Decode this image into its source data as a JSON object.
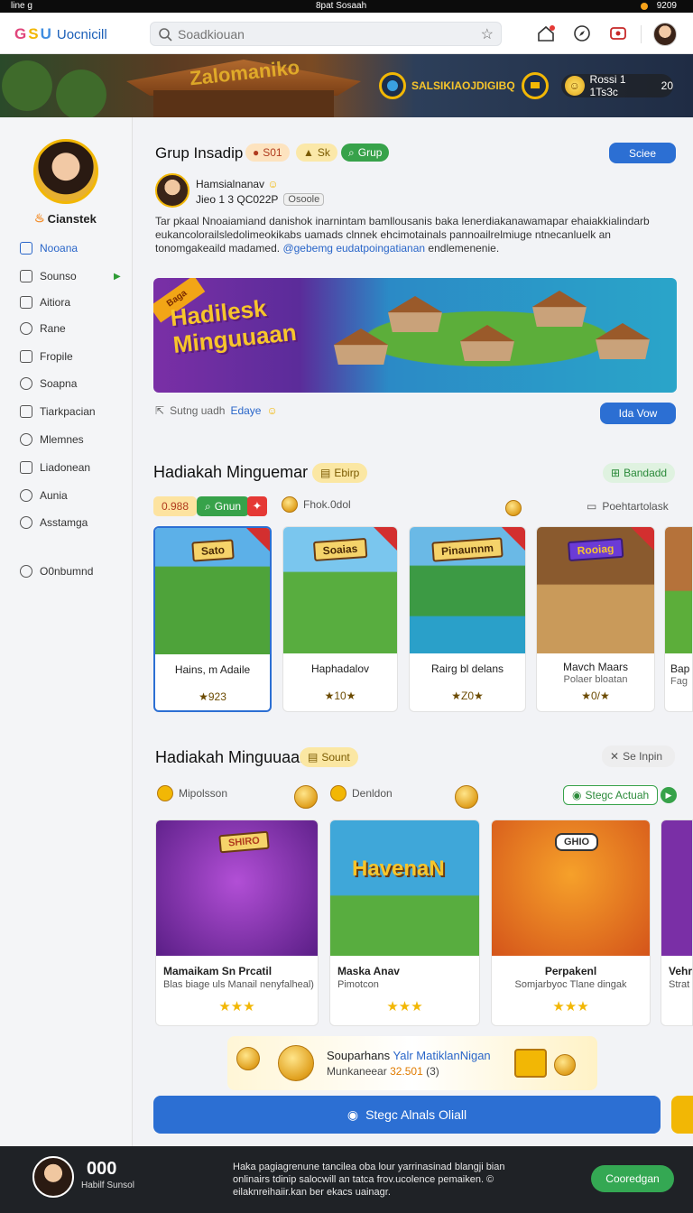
{
  "status_bar": {
    "left": "line g",
    "center": "8pat Sosaah",
    "right": "9209"
  },
  "topbar": {
    "logo_letters": [
      "G",
      "S",
      "U"
    ],
    "app_name": "Uocnicill",
    "search_placeholder": "Soadkiouan"
  },
  "banner": {
    "watermark": "Zalomaniko",
    "badge_text": "SALSIKIAOJDIGIBQ",
    "coins_label": "Rossi 1 1Ts3c",
    "coins_value": "20"
  },
  "sidebar": {
    "user_name": "Cianstek",
    "items": [
      {
        "label": "Nooana",
        "active": true
      },
      {
        "label": "Sounso",
        "active": false,
        "has_arrow": true
      },
      {
        "label": "Aitiora",
        "active": false
      },
      {
        "label": "Rane",
        "active": false
      },
      {
        "label": "Fropile",
        "active": false
      },
      {
        "label": "Soapna",
        "active": false
      },
      {
        "label": "Tiarkpacian",
        "active": false
      },
      {
        "label": "Mlemnes",
        "active": false
      },
      {
        "label": "Liadonean",
        "active": false
      },
      {
        "label": "Aunia",
        "active": false
      },
      {
        "label": "Asstamga",
        "active": false
      },
      {
        "label": "O0nbumnd",
        "active": false
      }
    ]
  },
  "group": {
    "title": "Grup Insadip",
    "chip_a": "S01",
    "chip_b": "Sk",
    "chip_c": "Grup",
    "join_label": "Sciee",
    "author_name": "Hamsialnanav",
    "author_id": "Jieo 1 3 QC022P",
    "author_tag": "Osoole",
    "description": "Tar pkaal Nnoaiamiand danishok inarnintam bamllousanis baka lenerdiakanawamapar ehaiakkialindarb eukancolorailsledolimeokikabs uamads clnnek ehcimotainals pannoailrelmiuge ntnecanluelk an tonomgakeaild madamed.",
    "description_link": "@gebemg eudatpoingatianan",
    "description_tail": "endlemenenie."
  },
  "hero": {
    "ribbon": "Baga",
    "title_line1": "Hadilesk",
    "title_line2": "Minguuaan",
    "footer_text": "Sutng uadh",
    "footer_link": "Edaye",
    "more_label": "Ida Vow"
  },
  "section1": {
    "title": "Hadiakah Minguemar",
    "title_pill": "Ebirp",
    "right_pill": "Bandadd",
    "filters": [
      {
        "label": "0.988"
      },
      {
        "label": "Gnun"
      },
      {
        "label": "Fhok.0dol"
      }
    ],
    "right_link": "Poehtartolask",
    "cards": [
      {
        "sign": "Sato",
        "name": "Hains, m Adaile",
        "rating": "★923"
      },
      {
        "sign": "Soaias",
        "name": "Haphadalov",
        "rating": "★10★"
      },
      {
        "sign": "Pinaunnm",
        "name": "Rairg bl delans",
        "rating": "★Z0★"
      },
      {
        "sign": "Rooiag",
        "name": "Mavch Maars",
        "sub": "Polaer bloatan",
        "rating": "★0/★"
      },
      {
        "sign": "",
        "name": "Bap",
        "sub": "Fag",
        "rating": ""
      }
    ]
  },
  "section2": {
    "title": "Hadiakah Minguuaan",
    "title_pill": "Sount",
    "right_pill": "Se Inpin",
    "filter_left": "Mipolsson",
    "filter_mid": "Denldon",
    "action_pill": "Stegc Actuah",
    "cards": [
      {
        "sign": "SHIRO",
        "name": "Mamaikam Sn Prcatil",
        "sub": "Blas biage uls Manail nenyfalheal)",
        "stars": "★★★"
      },
      {
        "sign": "HavenaN",
        "name": "Maska Anav",
        "sub": "Pimotcon",
        "stars": "★★★"
      },
      {
        "sign": "GHIO",
        "name": "Perpakenl",
        "sub": "Somjarbyoc Tlane dingak",
        "stars": "★★★"
      },
      {
        "sign": "",
        "name": "Vehr",
        "sub": "Strat",
        "stars": ""
      }
    ],
    "promo_line1": "Souparhans",
    "promo_line1_blue": "Yalr MatiklanNigan",
    "promo_line2": "Munkaneear",
    "promo_line2_orange": "32.501",
    "promo_line2_tail": "(3)",
    "big_button": "Stegc Alnals Oliall"
  },
  "footer": {
    "count": "000",
    "caption": "Habilf Sunsol",
    "text": "Haka pagiagrenune tancilea oba lour yarrinasinad blangji bian onlinairs tdinip salocwill an tatca frov.ucolence pemaiken. © eilaknreihaiir.kan ber ekacs uainagr.",
    "button": "Cooredgan"
  },
  "colors": {
    "accent": "#2c6fd3",
    "green": "#37a24a",
    "gold": "#f2b705",
    "footer_bg": "#1f2226"
  }
}
